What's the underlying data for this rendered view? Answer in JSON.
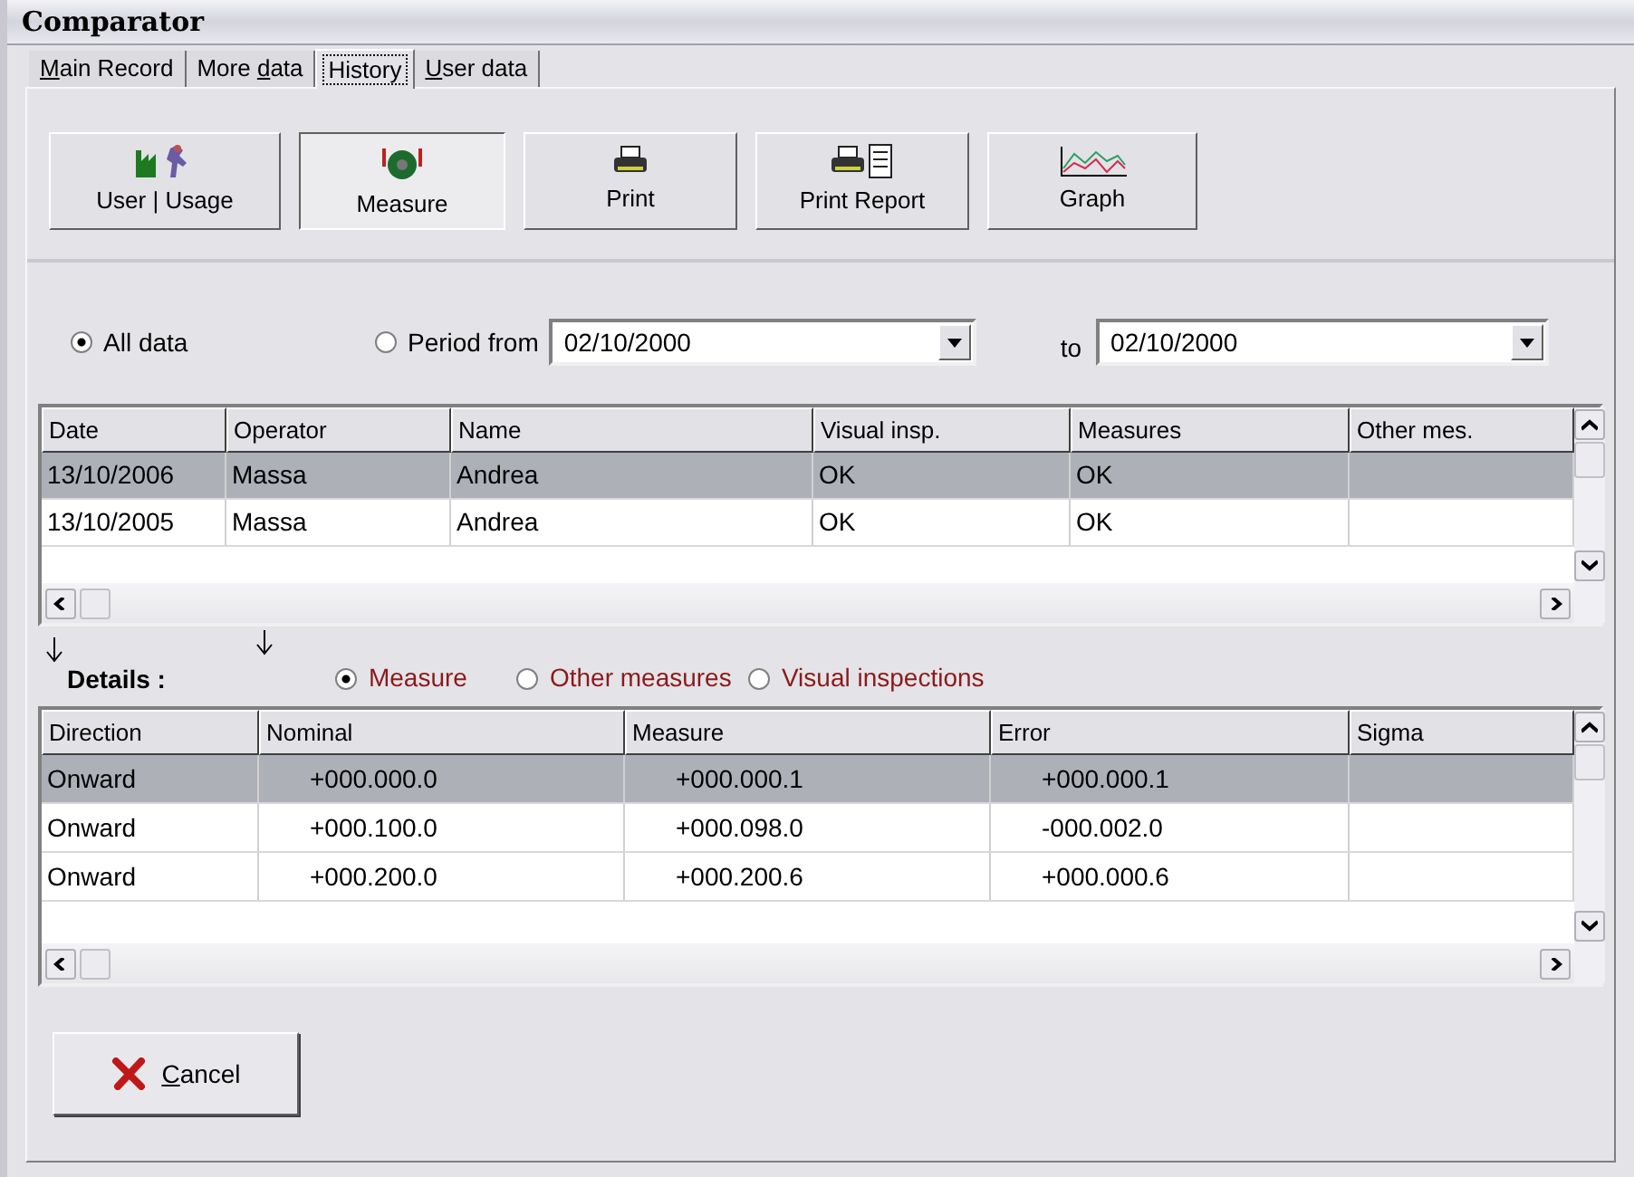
{
  "window": {
    "title": "Comparator"
  },
  "tabs": [
    {
      "label": "Main Record",
      "selected": false
    },
    {
      "label": "More data",
      "selected": false
    },
    {
      "label": "History",
      "selected": true
    },
    {
      "label": "User data",
      "selected": false
    }
  ],
  "toolbar": [
    {
      "label": "User | Usage",
      "kind": "usage",
      "selected": false
    },
    {
      "label": "Measure",
      "kind": "measure",
      "selected": true
    },
    {
      "label": "Print",
      "kind": "print",
      "selected": false
    },
    {
      "label": "Print Report",
      "kind": "report",
      "selected": false
    },
    {
      "label": "Graph",
      "kind": "graph",
      "selected": false
    }
  ],
  "filter": {
    "options": [
      {
        "label": "All data",
        "selected": true
      },
      {
        "label": "Period from",
        "selected": false
      }
    ],
    "from": "02/10/2000",
    "to_label": "to",
    "to": "02/10/2000"
  },
  "history_table": {
    "columns": [
      "Date",
      "Operator",
      "Name",
      "Visual insp.",
      "Measures",
      "Other mes."
    ],
    "rows": [
      {
        "cells": [
          "13/10/2006",
          "Massa",
          "Andrea",
          "OK",
          "OK",
          ""
        ],
        "selected": true
      },
      {
        "cells": [
          "13/10/2005",
          "Massa",
          "Andrea",
          "OK",
          "OK",
          ""
        ],
        "selected": false
      }
    ]
  },
  "details": {
    "label": "Details :",
    "options": [
      {
        "label": "Measure",
        "selected": true
      },
      {
        "label": "Other measures",
        "selected": false
      },
      {
        "label": "Visual inspections",
        "selected": false
      }
    ]
  },
  "details_table": {
    "columns": [
      "Direction",
      "Nominal",
      "Measure",
      "Error",
      "Sigma"
    ],
    "rows": [
      {
        "cells": [
          "Onward",
          "+000.000.0",
          "+000.000.1",
          "+000.000.1",
          ""
        ],
        "selected": true
      },
      {
        "cells": [
          "Onward",
          "+000.100.0",
          "+000.098.0",
          "-000.002.0",
          ""
        ],
        "selected": false
      },
      {
        "cells": [
          "Onward",
          "+000.200.0",
          "+000.200.6",
          "+000.000.6",
          ""
        ],
        "selected": false
      }
    ]
  },
  "cancel_button": {
    "label": "Cancel"
  }
}
